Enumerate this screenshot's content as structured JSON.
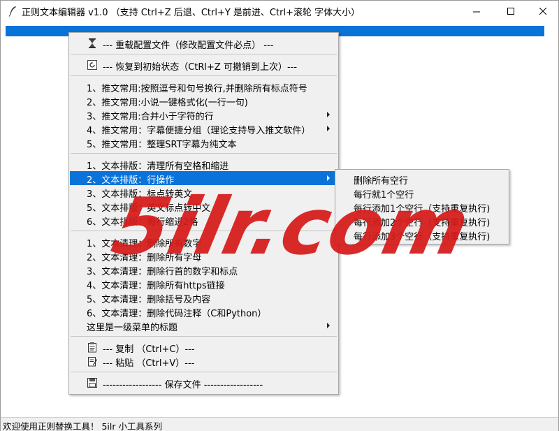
{
  "window": {
    "title": "正则文本编辑器 v1.0 （支持 Ctrl+Z 后退、Ctrl+Y 是前进、Ctrl+滚轮 字体大小）",
    "controls": {
      "minimize": "—",
      "maximize": "☐",
      "close": "✕"
    }
  },
  "menu": {
    "items": [
      {
        "label": "--- 重载配置文件（修改配置文件必点） ---",
        "icon": "hourglass-icon"
      },
      {
        "label": "--- 恢复到初始状态（CtRl+Z 可撤销到上次）---",
        "icon": "restore-icon"
      },
      {
        "label": "1、推文常用:按照逗号和句号换行,并删除所有标点符号"
      },
      {
        "label": "2、推文常用:小说一键格式化(一行一句)"
      },
      {
        "label": "3、推文常用:合并小于字符的行",
        "submenu": true
      },
      {
        "label": "4、推文常用：字幕便捷分组（理论支持导入推文软件）",
        "submenu": true
      },
      {
        "label": "5、推文常用：整理SRT字幕为纯文本"
      },
      {
        "label": "1、文本排版：清理所有空格和缩进"
      },
      {
        "label": "2、文本排版：行操作",
        "submenu": true,
        "active": true
      },
      {
        "label": "3、文本排版：标点转英文"
      },
      {
        "label": "5、文本排版：英文标点转中文"
      },
      {
        "label": "6、文本排版：每行缩进2格"
      },
      {
        "label": "1、文本清理：删除所有数字"
      },
      {
        "label": "2、文本清理：删除所有字母"
      },
      {
        "label": "3、文本清理：删除行首的数字和标点"
      },
      {
        "label": "4、文本清理：删除所有https链接"
      },
      {
        "label": "5、文本清理：删除括号及内容"
      },
      {
        "label": "6、文本清理：删除代码注释（C和Python）"
      },
      {
        "label": "这里是一级菜单的标题",
        "submenu": true
      },
      {
        "label": "--- 复制 （Ctrl+C）---",
        "icon": "clipboard-icon"
      },
      {
        "label": "--- 粘贴 （Ctrl+V）---",
        "icon": "paste-icon"
      },
      {
        "label": "------------------ 保存文件 ------------------",
        "icon": "save-icon"
      }
    ]
  },
  "submenu": {
    "items": [
      {
        "label": "删除所有空行"
      },
      {
        "label": "每行就1个空行"
      },
      {
        "label": "每行添加1个空行（支持重复执行)"
      },
      {
        "label": "每行添加2个空行（支持重复执行)"
      },
      {
        "label": "每行添加3个空行（支持重复执行)"
      }
    ]
  },
  "statusbar": {
    "text": "欢迎使用正则替换工具！ 5ilr 小工具系列"
  },
  "watermark": {
    "text": "5ilr.com",
    "color": "#d61a1a"
  },
  "colors": {
    "selection": "#0a73d9",
    "menu_bg": "#f0f0f0"
  }
}
